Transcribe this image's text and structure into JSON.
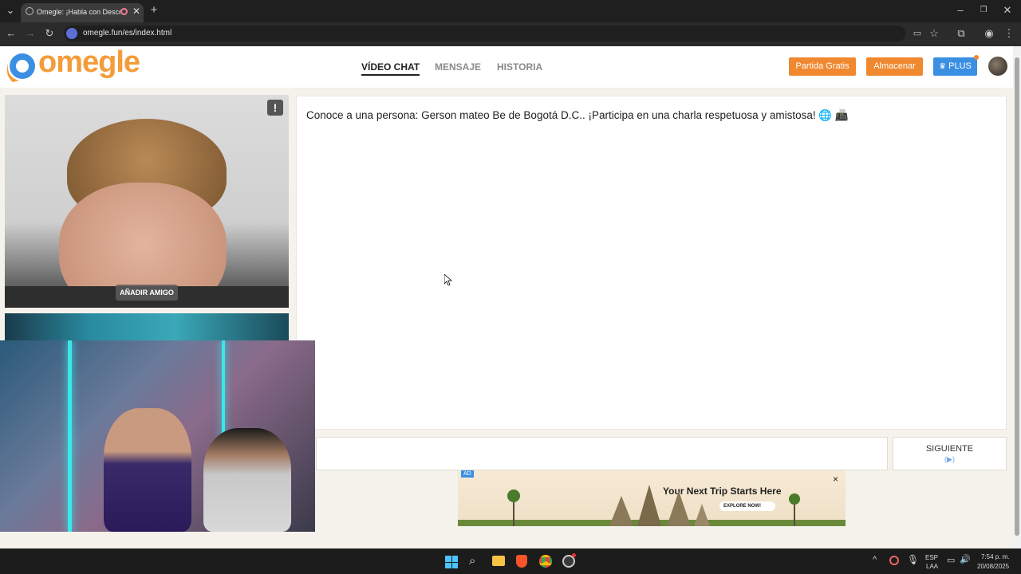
{
  "browser": {
    "tab_title": "Omegle: ¡Habla con Desconocidos!",
    "new_tab_symbol": "+",
    "url": "omegle.fun/es/index.html"
  },
  "site": {
    "logo": "omegle",
    "nav": [
      {
        "label": "VÍDEO CHAT",
        "active": true
      },
      {
        "label": "MENSAJE",
        "active": false
      },
      {
        "label": "HISTORIA",
        "active": false
      }
    ],
    "buttons": {
      "free_match": "Partida Gratis",
      "store": "Almacenar",
      "plus": "PLUS"
    },
    "colors": {
      "brand": "#f39c38",
      "orange_button": "#f0882f",
      "plus_button": "#3b8fe3"
    }
  },
  "video": {
    "add_friend": "AÑADIR AMIGO",
    "report_icon": "exclamation-icon"
  },
  "chat": {
    "message": "Conoce a una persona: Gerson mateo Be de Bogotá D.C.. ¡Participa en una charla respetuosa y amistosa! 🌐 📠",
    "next_label": "SIGUIENTE"
  },
  "ad": {
    "badge": "AD",
    "headline": "Your Next Trip Starts Here",
    "cta": "EXPLORE NOW!",
    "close": "×"
  },
  "taskbar": {
    "language_top": "ESP",
    "language_bottom": "LAA",
    "time": "7:54 p. m.",
    "date": "20/08/2025"
  }
}
